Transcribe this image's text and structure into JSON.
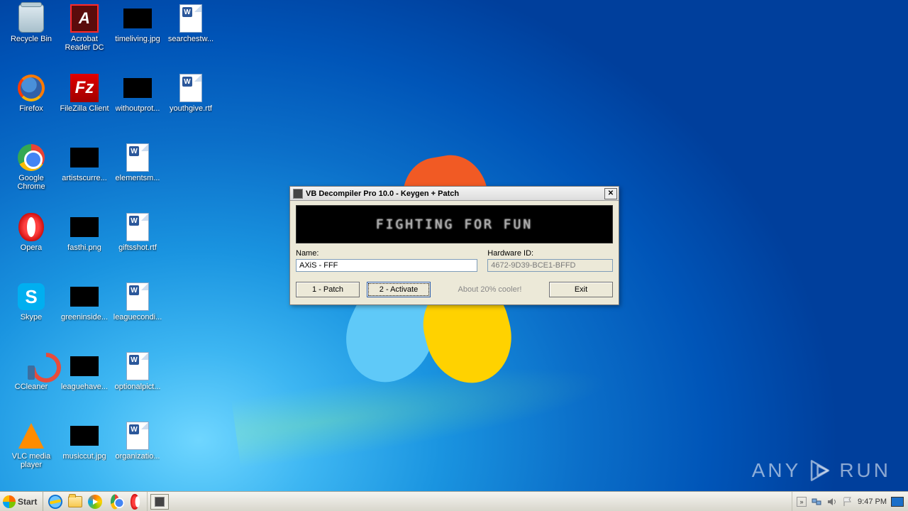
{
  "desktop": {
    "icons": [
      {
        "label": "Recycle Bin",
        "kind": "bin",
        "col": 0,
        "row": 0
      },
      {
        "label": "Acrobat Reader DC",
        "kind": "adobe",
        "col": 1,
        "row": 0,
        "two": true
      },
      {
        "label": "timeliving.jpg",
        "kind": "black",
        "col": 2,
        "row": 0
      },
      {
        "label": "searchestw...",
        "kind": "doc",
        "col": 3,
        "row": 0
      },
      {
        "label": "Firefox",
        "kind": "ff",
        "col": 0,
        "row": 1
      },
      {
        "label": "FileZilla Client",
        "kind": "fz",
        "col": 1,
        "row": 1
      },
      {
        "label": "withoutprot...",
        "kind": "black",
        "col": 2,
        "row": 1
      },
      {
        "label": "youthgive.rtf",
        "kind": "doc",
        "col": 3,
        "row": 1
      },
      {
        "label": "Google Chrome",
        "kind": "chrome",
        "col": 0,
        "row": 2,
        "two": true
      },
      {
        "label": "artistscurre...",
        "kind": "black",
        "col": 1,
        "row": 2
      },
      {
        "label": "elementsm...",
        "kind": "doc",
        "col": 2,
        "row": 2
      },
      {
        "label": "Opera",
        "kind": "opera",
        "col": 0,
        "row": 3
      },
      {
        "label": "fasthi.png",
        "kind": "black",
        "col": 1,
        "row": 3
      },
      {
        "label": "giftsshot.rtf",
        "kind": "doc",
        "col": 2,
        "row": 3
      },
      {
        "label": "Skype",
        "kind": "skype",
        "col": 0,
        "row": 4
      },
      {
        "label": "greeninside...",
        "kind": "black",
        "col": 1,
        "row": 4
      },
      {
        "label": "leaguecondi...",
        "kind": "doc",
        "col": 2,
        "row": 4
      },
      {
        "label": "CCleaner",
        "kind": "cc",
        "col": 0,
        "row": 5
      },
      {
        "label": "leaguehave...",
        "kind": "black",
        "col": 1,
        "row": 5
      },
      {
        "label": "optionalpict...",
        "kind": "doc",
        "col": 2,
        "row": 5
      },
      {
        "label": "VLC media player",
        "kind": "vlc",
        "col": 0,
        "row": 6,
        "two": true
      },
      {
        "label": "musiccut.jpg",
        "kind": "black",
        "col": 1,
        "row": 6
      },
      {
        "label": "organizatio...",
        "kind": "doc",
        "col": 2,
        "row": 6
      }
    ]
  },
  "dialog": {
    "title": "VB Decompiler Pro 10.0 - Keygen + Patch",
    "banner_text": "FIGHTING FOR FUN",
    "name_label": "Name:",
    "name_value": "AXiS - FFF",
    "hwid_label": "Hardware ID:",
    "hwid_value": "4672-9D39-BCE1-BFFD",
    "patch_btn": "1 - Patch",
    "activate_btn": "2 - Activate",
    "cooler_text": "About 20% cooler!",
    "exit_btn": "Exit"
  },
  "taskbar": {
    "start": "Start",
    "clock": "9:47 PM"
  },
  "watermark": {
    "brand": "ANY",
    "brand2": "RUN"
  }
}
